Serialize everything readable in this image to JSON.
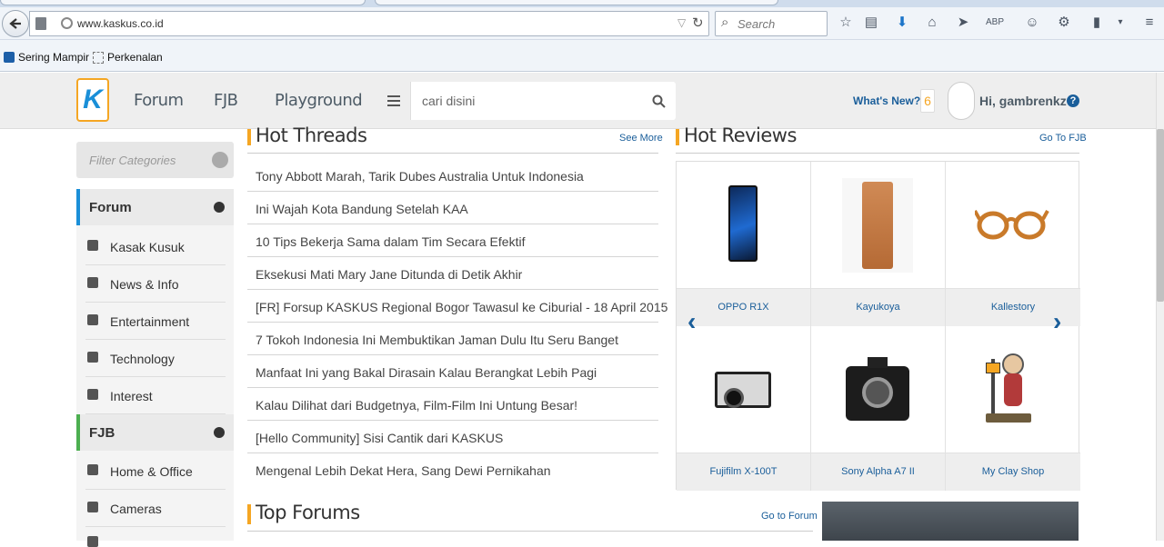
{
  "browser": {
    "url": "www.kaskus.co.id",
    "search_placeholder": "Search",
    "bookmarks": [
      "Sering Mampir",
      "Perkenalan"
    ]
  },
  "header": {
    "logo_letter": "K",
    "nav": [
      "Forum",
      "FJB",
      "Playground"
    ],
    "search_placeholder": "cari disini",
    "whats_new": "What's New?",
    "notif_count": "6",
    "greeting": "Hi, gambrenkz",
    "help": "?"
  },
  "sidebar": {
    "filter_placeholder": "Filter Categories",
    "forum": {
      "label": "Forum",
      "items": [
        "Kasak Kusuk",
        "News & Info",
        "Entertainment",
        "Technology",
        "Interest"
      ]
    },
    "fjb": {
      "label": "FJB",
      "items": [
        "Home & Office",
        "Cameras"
      ]
    },
    "colors": {
      "forum_accent": "#1a8fd8",
      "fjb_accent": "#4caf50"
    }
  },
  "hot_threads": {
    "title": "Hot Threads",
    "link": "See More",
    "items": [
      "Tony Abbott Marah, Tarik Dubes Australia Untuk Indonesia",
      "Ini Wajah Kota Bandung Setelah KAA",
      "10 Tips Bekerja Sama dalam Tim Secara Efektif",
      "Eksekusi Mati Mary Jane Ditunda di Detik Akhir",
      "[FR] Forsup KASKUS Regional Bogor Tawasul ke Ciburial - 18 April 2015",
      "7 Tokoh Indonesia Ini Membuktikan Jaman Dulu Itu Seru Banget",
      "Manfaat Ini yang Bakal Dirasain Kalau Berangkat Lebih Pagi",
      "Kalau Dilihat dari Budgetnya, Film-Film Ini Untung Besar!",
      "[Hello Community] Sisi Cantik dari KASKUS",
      "Mengenal Lebih Dekat Hera, Sang Dewi Pernikahan"
    ]
  },
  "hot_reviews": {
    "title": "Hot Reviews",
    "link": "Go To FJB",
    "products": [
      "OPPO R1X",
      "Kayukoya",
      "Kallestory",
      "Fujifilm X-100T",
      "Sony Alpha A7 II",
      "My Clay Shop"
    ]
  },
  "top_forums": {
    "title": "Top Forums",
    "link": "Go to Forum"
  }
}
